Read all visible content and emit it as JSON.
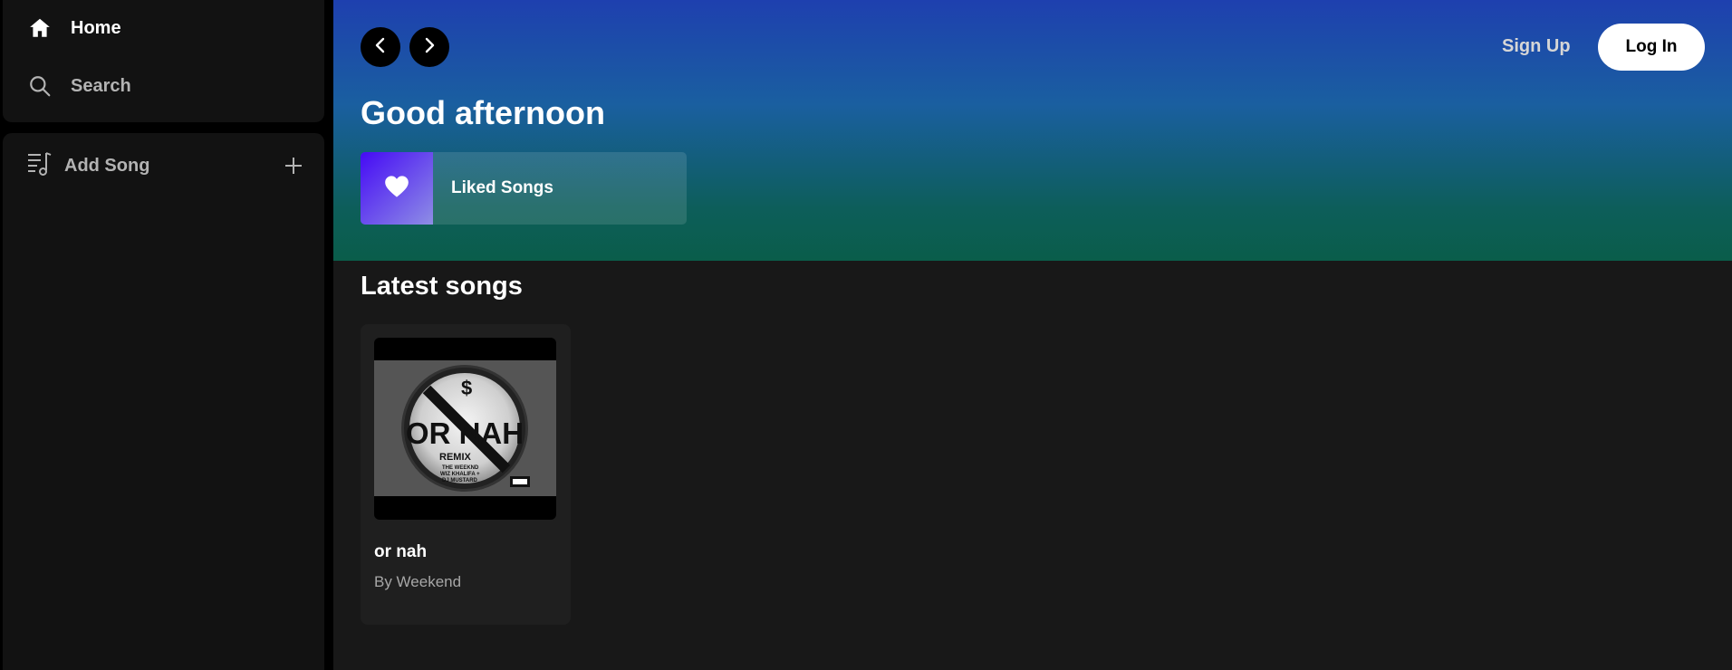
{
  "sidebar": {
    "nav": [
      {
        "label": "Home",
        "icon": "home-icon"
      },
      {
        "label": "Search",
        "icon": "search-icon"
      }
    ],
    "library": {
      "label": "Add Song",
      "icon": "playlist-add-icon",
      "action_icon": "plus-icon"
    }
  },
  "header": {
    "signup_label": "Sign Up",
    "login_label": "Log In"
  },
  "hero": {
    "greeting": "Good afternoon",
    "liked": {
      "label": "Liked Songs",
      "icon": "heart-icon"
    }
  },
  "latest": {
    "title": "Latest songs",
    "songs": [
      {
        "title": "or nah",
        "artist": "By Weekend",
        "cover": {
          "main": "OR NAH",
          "remix": "REMIX",
          "credits": [
            "THE WEEKND",
            "WIZ KHALIFA +",
            "DJ MUSTARD"
          ]
        }
      }
    ]
  },
  "colors": {
    "hero_top": "#1e40af",
    "hero_bottom": "#0a5d4a",
    "surface": "#121212",
    "main_bg": "#181818"
  }
}
